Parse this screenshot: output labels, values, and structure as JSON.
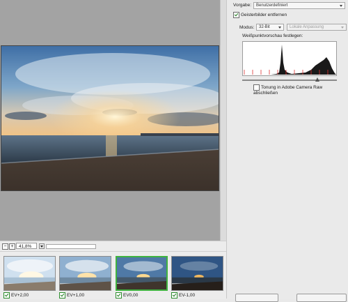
{
  "preview": {
    "zoom_value": "41,8%"
  },
  "filmstrip": {
    "thumbnails": [
      {
        "label": "EV+2,00",
        "checked": true,
        "selected": false
      },
      {
        "label": "EV+1,00",
        "checked": true,
        "selected": false
      },
      {
        "label": "EV0,00",
        "checked": true,
        "selected": true
      },
      {
        "label": "EV-1,00",
        "checked": true,
        "selected": false
      }
    ]
  },
  "settings": {
    "preset_label": "Vorgabe:",
    "preset_value": "Benutzerdefiniert",
    "ghost_label": "Geisterbilder entfernen",
    "ghost_checked": true,
    "mode_label": "Modus:",
    "mode_value": "32-Bit",
    "adjust_value": "Lokale Anpassung",
    "whitepoint_label": "Weißpunktvorschau festlegen:",
    "toning_label": "Tonung in Adobe Camera Raw abschließen",
    "toning_checked": false
  },
  "colors": {
    "selected_border": "#3fb33f",
    "preview_bg": "#a3a3a3",
    "panel_bg": "#eaeaea",
    "histogram_marker": "#d33"
  }
}
